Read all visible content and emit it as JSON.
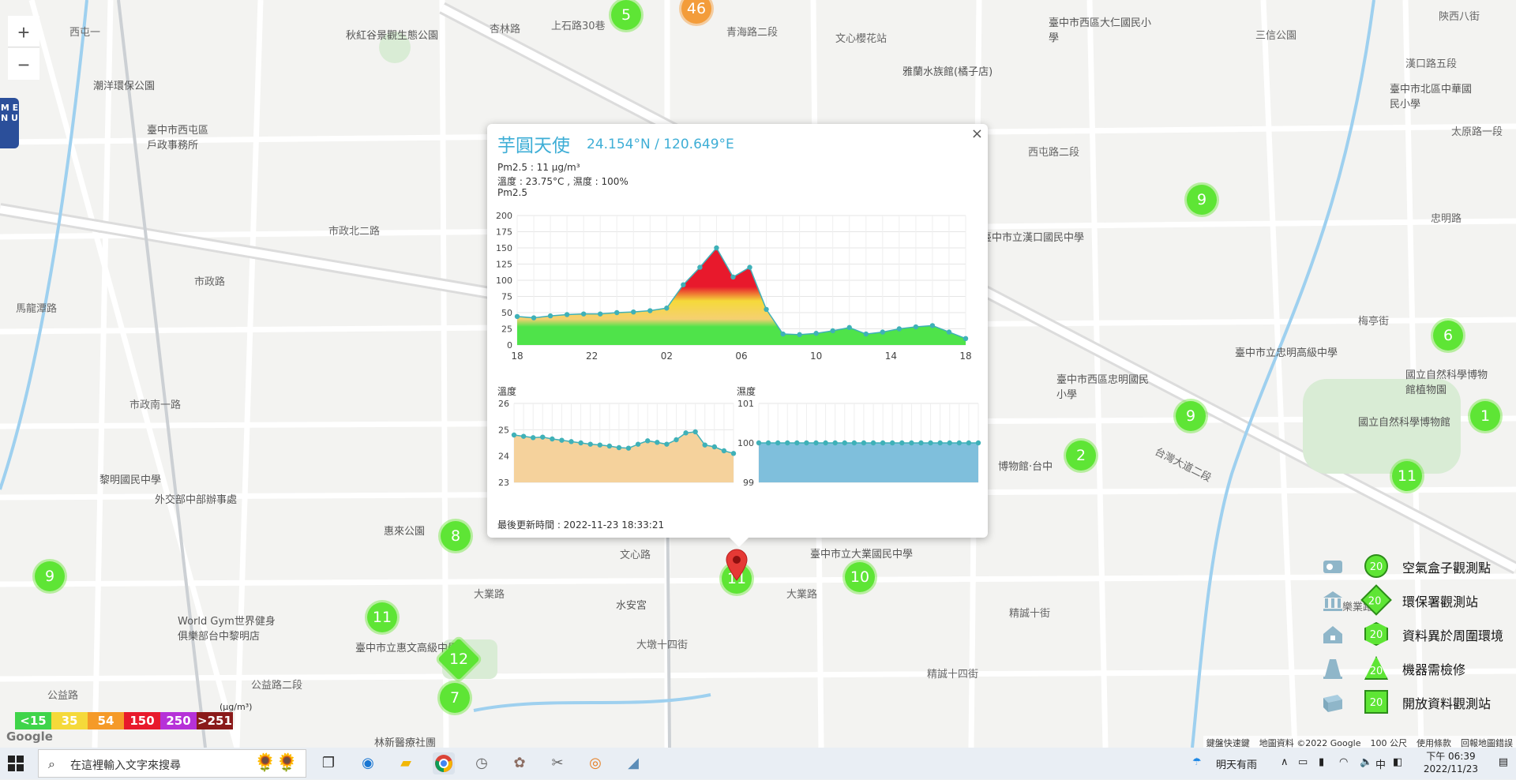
{
  "map": {
    "labels": [
      {
        "t": "秋紅谷景觀生態公園"
      },
      {
        "t": "西屯一"
      },
      {
        "t": "杏林路"
      },
      {
        "t": "上石路30巷"
      },
      {
        "t": "青海路二段"
      },
      {
        "t": "文心櫻花站"
      },
      {
        "t": "臺中市西區大仁國民小學"
      },
      {
        "t": "三信公園"
      },
      {
        "t": "陝西八街"
      },
      {
        "t": "漢口路五段"
      },
      {
        "t": "潮洋環保公園"
      },
      {
        "t": "臺中市西屯區戶政事務所"
      },
      {
        "t": "雅蘭水族館(橘子店)"
      },
      {
        "t": "臺中市北區中華國民小學"
      },
      {
        "t": "太原路一段"
      },
      {
        "t": "西屯路二段"
      },
      {
        "t": "臺中市立漢口國民中學"
      },
      {
        "t": "市政北二路"
      },
      {
        "t": "市政路"
      },
      {
        "t": "馬龍潭路"
      },
      {
        "t": "市政南一路"
      },
      {
        "t": "黎明國民中學"
      },
      {
        "t": "外交部中部辦事處"
      },
      {
        "t": "惠來公園"
      },
      {
        "t": "文心路"
      },
      {
        "t": "臺中市立大業國民中學"
      },
      {
        "t": "大業路"
      },
      {
        "t": "水安宮"
      },
      {
        "t": "World Gym世界健身俱樂部台中黎明店"
      },
      {
        "t": "臺中市立惠文高級中學"
      },
      {
        "t": "公益路二段"
      },
      {
        "t": "大墩十四街"
      },
      {
        "t": "精誠十街"
      },
      {
        "t": "精誠十四街"
      },
      {
        "t": "臺中市立忠明高級中學"
      },
      {
        "t": "臺中市西區忠明國民小學"
      },
      {
        "t": "國立自然科學博物館植物園"
      },
      {
        "t": "國立自然科學博物館"
      },
      {
        "t": "台灣大道二段"
      },
      {
        "t": "樂業路"
      },
      {
        "t": "林新醫療社團"
      },
      {
        "t": "博物館·台中"
      },
      {
        "t": "大業路"
      },
      {
        "t": "公益路"
      },
      {
        "t": "梅亭街"
      },
      {
        "t": "忠明路"
      }
    ],
    "markers": [
      {
        "label": "5",
        "style": "green"
      },
      {
        "label": "46",
        "style": "orange"
      },
      {
        "label": "9",
        "style": "green"
      },
      {
        "label": "6",
        "style": "green"
      },
      {
        "label": "9",
        "style": "green"
      },
      {
        "label": "1",
        "style": "green"
      },
      {
        "label": "2",
        "style": "green"
      },
      {
        "label": "11",
        "style": "green"
      },
      {
        "label": "8",
        "style": "green"
      },
      {
        "label": "9",
        "style": "green"
      },
      {
        "label": "10",
        "style": "green"
      },
      {
        "label": "11",
        "style": "green"
      },
      {
        "label": "11",
        "style": "green"
      },
      {
        "label": "12",
        "style": "diamond"
      },
      {
        "label": "7",
        "style": "green"
      }
    ]
  },
  "controls": {
    "zoom_in": "+",
    "zoom_out": "−",
    "menu": "M E N U"
  },
  "popup": {
    "close": "×",
    "station": "芋圓天使",
    "coord": "24.154°N / 120.649°E",
    "pm_line": "Pm2.5 : 11 μg/m³",
    "env_line": "溫度 : 23.75°C , 濕度 : 100%",
    "pm_title": "Pm2.5",
    "temp_title": "溫度",
    "hum_title": "濕度",
    "updated": "最後更新時間 : 2022-11-23 18:33:21"
  },
  "chart_data": [
    {
      "type": "area",
      "title": "Pm2.5",
      "x_ticks": [
        "18",
        "22",
        "02",
        "06",
        "10",
        "14",
        "18"
      ],
      "ylim": [
        0,
        200
      ],
      "y_ticks": [
        0,
        25,
        50,
        75,
        100,
        125,
        150,
        175,
        200
      ],
      "grid": true,
      "series": [
        {
          "values": [
            44,
            42,
            45,
            47,
            48,
            48,
            50,
            51,
            53,
            57,
            93,
            120,
            150,
            105,
            120,
            55,
            17,
            16,
            18,
            22,
            27,
            17,
            20,
            25,
            28,
            30,
            20,
            10
          ]
        }
      ]
    },
    {
      "type": "area",
      "title": "溫度",
      "ylim": [
        23,
        26
      ],
      "y_ticks": [
        23,
        24,
        25,
        26
      ],
      "grid": true,
      "series": [
        {
          "values": [
            24.8,
            24.75,
            24.7,
            24.72,
            24.65,
            24.6,
            24.55,
            24.5,
            24.45,
            24.42,
            24.38,
            24.32,
            24.3,
            24.45,
            24.58,
            24.52,
            24.45,
            24.62,
            24.88,
            24.92,
            24.42,
            24.35,
            24.2,
            24.1
          ]
        }
      ]
    },
    {
      "type": "area",
      "title": "濕度",
      "ylim": [
        99,
        101
      ],
      "y_ticks": [
        99,
        100,
        101
      ],
      "grid": true,
      "series": [
        {
          "values": [
            100,
            100,
            100,
            100,
            100,
            100,
            100,
            100,
            100,
            100,
            100,
            100,
            100,
            100,
            100,
            100,
            100,
            100,
            100,
            100,
            100,
            100,
            100,
            100
          ]
        }
      ]
    }
  ],
  "legend": [
    {
      "label": "空氣盒子觀測點",
      "mk": "20"
    },
    {
      "label": "環保署觀測站",
      "mk": "20"
    },
    {
      "label": "資料異於周圍環境",
      "mk": "20"
    },
    {
      "label": "機器需檢修",
      "mk": "20"
    },
    {
      "label": "開放資料觀測站",
      "mk": "20"
    }
  ],
  "aqi_scale": [
    {
      "label": "<15",
      "color": "#3fd44a"
    },
    {
      "label": "35",
      "color": "#f5d93a"
    },
    {
      "label": "54",
      "color": "#f59a28"
    },
    {
      "label": "150",
      "color": "#e8192c"
    },
    {
      "label": "250",
      "color": "#b631d8"
    },
    {
      "label": ">251",
      "color": "#8a1a1a"
    }
  ],
  "aqi_unit": "(μg/m³)",
  "google": "Google",
  "attribution": [
    "鍵盤快速鍵",
    "地圖資料 ©2022 Google",
    "100 公尺",
    "使用條款",
    "回報地圖錯誤"
  ],
  "taskbar": {
    "search_placeholder": "在這裡輸入文字來搜尋",
    "weather": "明天有雨",
    "ime": "中",
    "time": "下午 06:39",
    "date": "2022/11/23"
  }
}
